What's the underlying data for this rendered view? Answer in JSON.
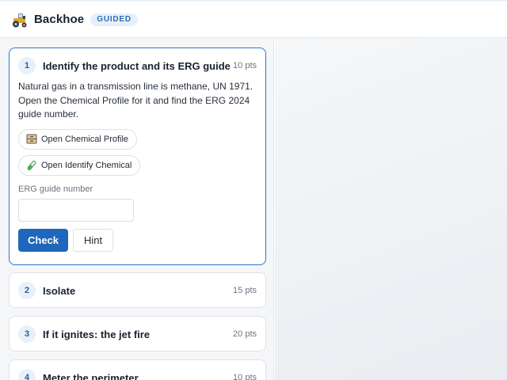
{
  "header": {
    "app_name": "Backhoe",
    "mode_badge": "GUIDED",
    "logo_icon": "tractor-icon"
  },
  "colors": {
    "accent": "#1f67bb",
    "active_border": "#2f78c4",
    "badge_bg": "#e6f0fa",
    "badge_text": "#2f6fb4"
  },
  "tasks": [
    {
      "number": "1",
      "title": "Identify the product and its ERG guide",
      "points": "10 pts",
      "active": true,
      "description": "Natural gas in a transmission line is methane, UN 1971. Open the Chemical Profile for it and find the ERG 2024 guide number.",
      "tools": [
        {
          "label": "Open Chemical Profile",
          "icon": "cabinet-icon"
        },
        {
          "label": "Open Identify Chemical",
          "icon": "test-tube-icon"
        }
      ],
      "field_label": "ERG guide number",
      "field_value": "",
      "field_placeholder": "",
      "check_label": "Check",
      "hint_label": "Hint"
    },
    {
      "number": "2",
      "title": "Isolate",
      "points": "15 pts",
      "active": false
    },
    {
      "number": "3",
      "title": "If it ignites: the jet fire",
      "points": "20 pts",
      "active": false
    },
    {
      "number": "4",
      "title": "Meter the perimeter",
      "points": "10 pts",
      "active": false
    }
  ]
}
